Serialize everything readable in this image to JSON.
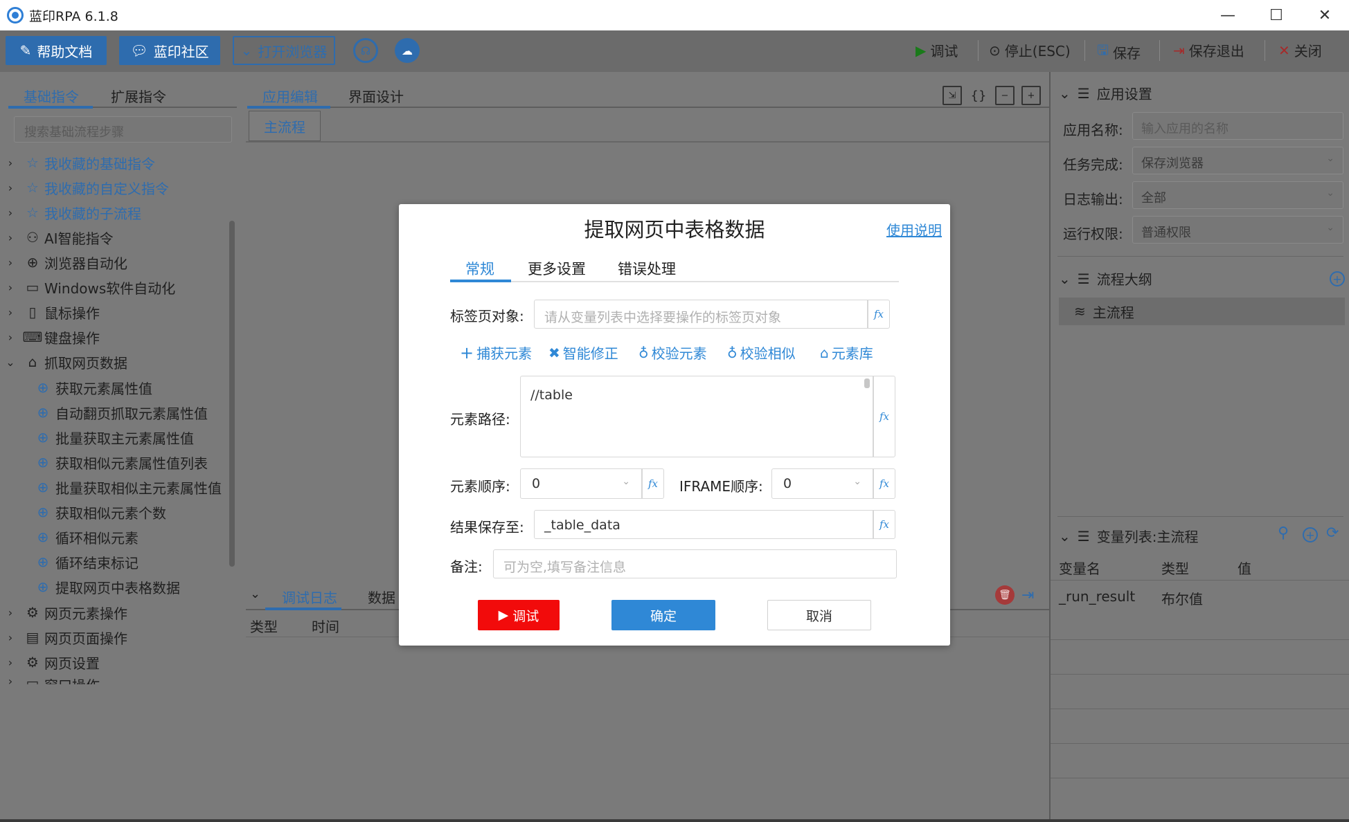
{
  "window": {
    "title": "蓝印RPA 6.1.8",
    "controls": {
      "minimize": "—",
      "maximize": "☐",
      "close": "✕"
    }
  },
  "toolbar": {
    "help_docs": "帮助文档",
    "community": "蓝印社区",
    "open_browser": "打开浏览器",
    "debug": "调试",
    "stop": "停止(ESC)",
    "save": "保存",
    "save_exit": "保存退出",
    "close": "关闭"
  },
  "left_panel": {
    "tabs": [
      "基础指令",
      "扩展指令"
    ],
    "search_placeholder": "搜索基础流程步骤",
    "items": [
      {
        "label": "我收藏的基础指令",
        "icon": "star-icon"
      },
      {
        "label": "我收藏的自定义指令",
        "icon": "star-icon"
      },
      {
        "label": "我收藏的子流程",
        "icon": "star-icon"
      },
      {
        "label": "AI智能指令",
        "icon": "robot-icon"
      },
      {
        "label": "浏览器自动化",
        "icon": "globe-icon"
      },
      {
        "label": "Windows软件自动化",
        "icon": "monitor-icon"
      },
      {
        "label": "鼠标操作",
        "icon": "mouse-icon"
      },
      {
        "label": "键盘操作",
        "icon": "keyboard-icon"
      },
      {
        "label": "抓取网页数据",
        "icon": "tag-icon"
      },
      {
        "label": "网页元素操作",
        "icon": "gear-icon"
      },
      {
        "label": "网页页面操作",
        "icon": "window-icon"
      },
      {
        "label": "网页设置",
        "icon": "gear-icon"
      },
      {
        "label": "窗口操作",
        "icon": "window-icon"
      }
    ],
    "children": [
      "获取元素属性值",
      "自动翻页抓取元素属性值",
      "批量获取主元素属性值",
      "获取相似元素属性值列表",
      "批量获取相似主元素属性值",
      "获取相似元素个数",
      "循环相似元素",
      "循环结束标记",
      "提取网页中表格数据"
    ]
  },
  "center": {
    "tabs": [
      "应用编辑",
      "界面设计"
    ],
    "flow_tab": "主流程",
    "log_tabs": [
      "调试日志",
      "数据查"
    ],
    "log_columns": [
      "类型",
      "时间"
    ]
  },
  "right_panel": {
    "app_settings": "应用设置",
    "app_name_label": "应用名称:",
    "app_name_placeholder": "输入应用的名称",
    "task_done_label": "任务完成:",
    "task_done_value": "保存浏览器",
    "log_output_label": "日志输出:",
    "log_output_value": "全部",
    "run_perm_label": "运行权限:",
    "run_perm_value": "普通权限",
    "outline": "流程大纲",
    "main_flow": "主流程",
    "var_list": "变量列表:主流程",
    "var_columns": [
      "变量名",
      "类型",
      "值"
    ],
    "var_rows": [
      {
        "name": "_run_result",
        "type": "布尔值",
        "value": ""
      }
    ]
  },
  "modal": {
    "title": "提取网页中表格数据",
    "help": "使用说明",
    "tabs": [
      "常规",
      "更多设置",
      "错误处理"
    ],
    "tab_label": "标签页对象:",
    "tab_placeholder": "请从变量列表中选择要操作的标签页对象",
    "actions": [
      "捕获元素",
      "智能修正",
      "校验元素",
      "校验相似",
      "元素库"
    ],
    "path_label": "元素路径:",
    "path_value": "//table",
    "order_label": "元素顺序:",
    "order_value": "0",
    "iframe_label": "IFRAME顺序:",
    "iframe_value": "0",
    "save_label": "结果保存至:",
    "save_value": "_table_data",
    "note_label": "备注:",
    "note_placeholder": "可为空,填写备注信息",
    "fx": "fx",
    "btn_debug": "调试",
    "btn_ok": "确定",
    "btn_cancel": "取消"
  },
  "colors": {
    "accent": "#2f88d6",
    "debug_red": "#f20b0b",
    "overlay": "#7a7a7a"
  }
}
